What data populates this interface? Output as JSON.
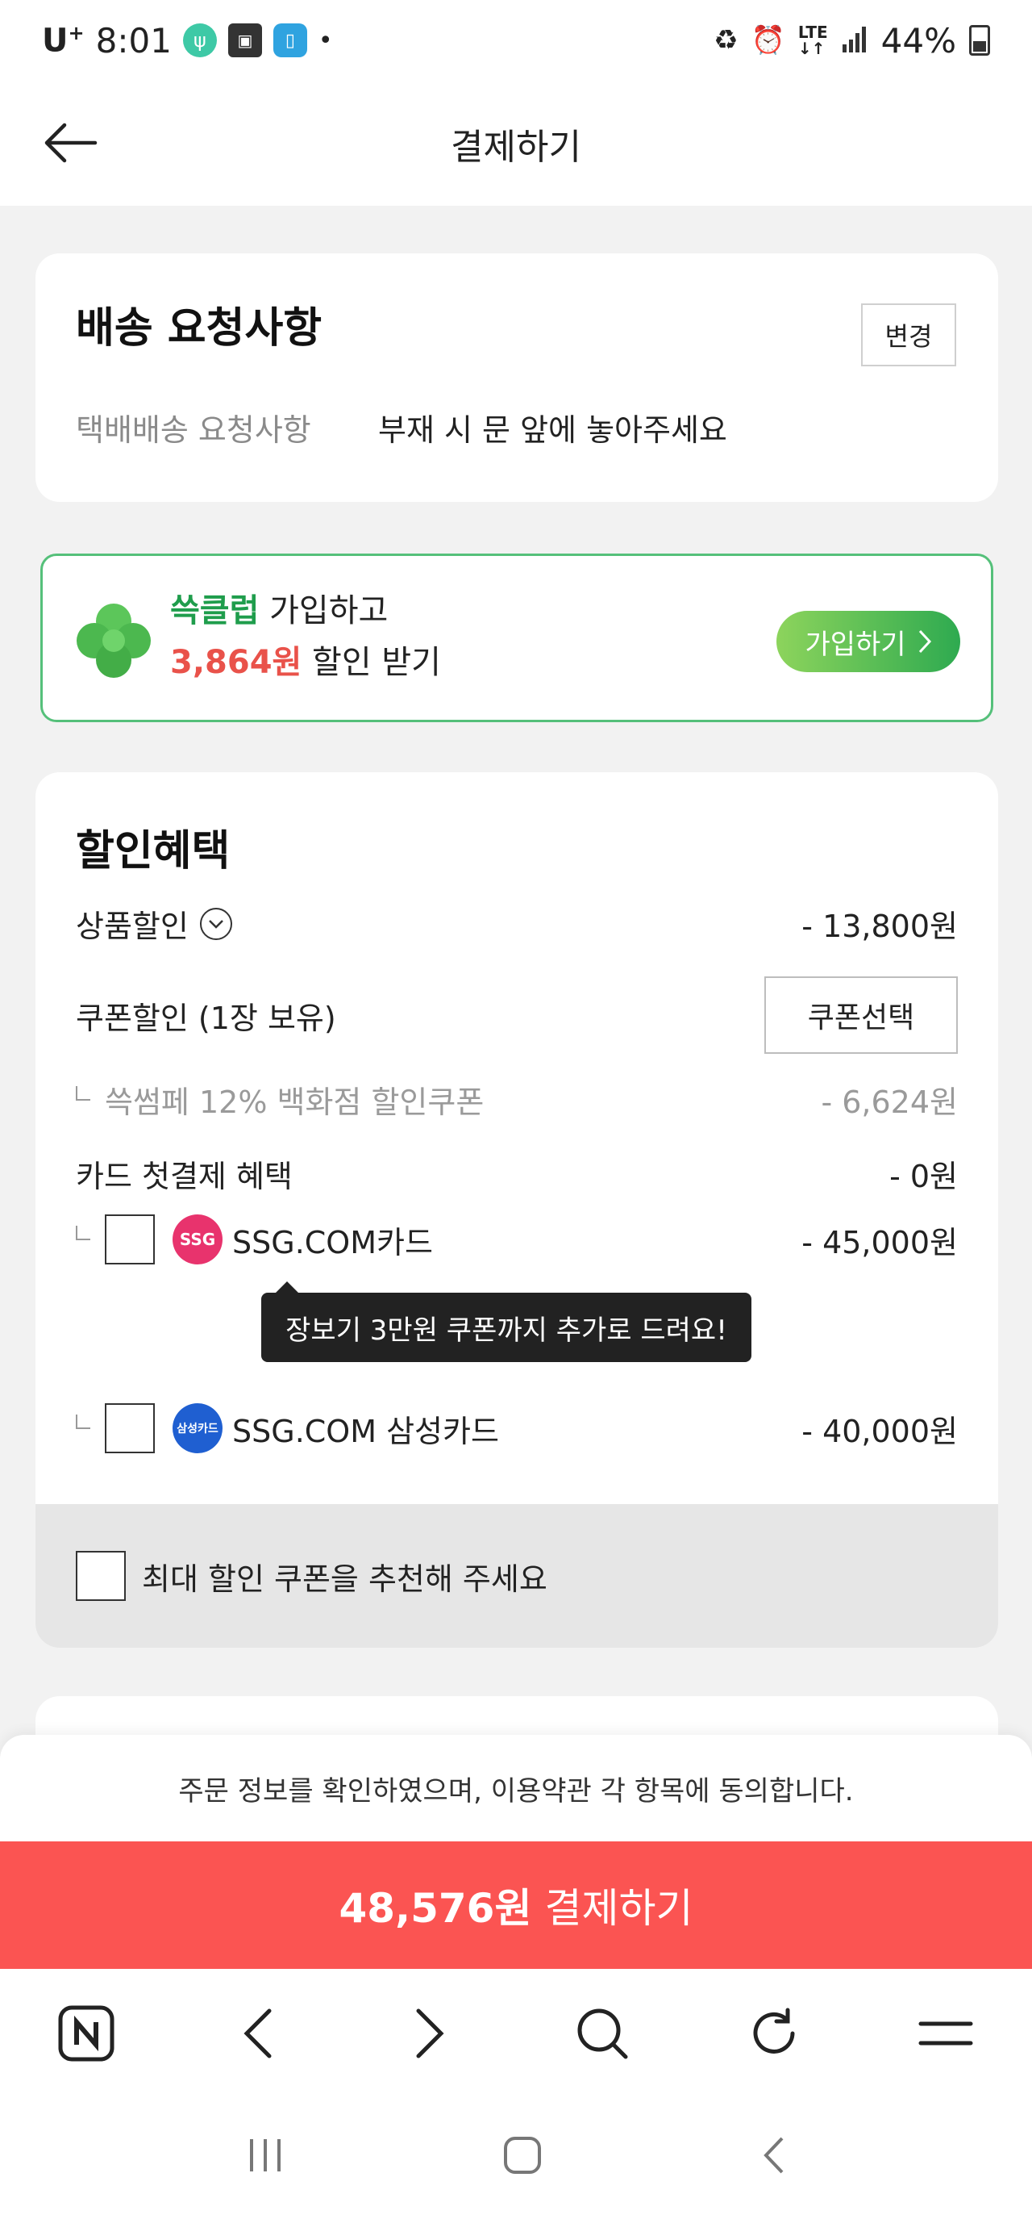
{
  "status_bar": {
    "carrier": "U",
    "carrier_sup": "+",
    "time": "8:01",
    "battery": "44%"
  },
  "header": {
    "title": "결제하기"
  },
  "delivery": {
    "title": "배송 요청사항",
    "change_label": "변경",
    "request_label": "택배배송 요청사항",
    "request_value": "부재 시 문 앞에 놓아주세요"
  },
  "club_banner": {
    "brand": "쓱클럽",
    "line1_rest": " 가입하고",
    "amount": "3,864원",
    "line2_rest": " 할인 받기",
    "join_label": "가입하기"
  },
  "discount": {
    "title": "할인혜택",
    "product_discount_label": "상품할인",
    "product_discount_amount": "- 13,800원",
    "coupon_label": "쿠폰할인 (1장 보유)",
    "coupon_button": "쿠폰선택",
    "coupon_sub_label": "쓱썸페 12% 백화점 할인쿠폰",
    "coupon_sub_amount": "- 6,624원",
    "card_first_label": "카드 첫결제 혜택",
    "card_first_amount": "- 0원",
    "cards": [
      {
        "badge": "SSG",
        "name": "SSG.COM카드",
        "amount": "- 45,000원",
        "color": "#e8336d"
      },
      {
        "badge": "삼성카드",
        "name": "SSG.COM 삼성카드",
        "amount": "- 40,000원",
        "color": "#1f5fd1"
      }
    ],
    "tooltip": "장보기 3만원 쿠폰까지 추가로 드려요!",
    "recommend_label": "최대 할인 쿠폰을 추천해 주세요"
  },
  "agreement": "주문 정보를 확인하였으며, 이용약관 각 항목에 동의합니다.",
  "pay": {
    "price": "48,576원",
    "label": "결제하기"
  },
  "colors": {
    "accent_red": "#fb5452",
    "brand_green": "#1f9d4c",
    "amount_red": "#e9524a"
  }
}
